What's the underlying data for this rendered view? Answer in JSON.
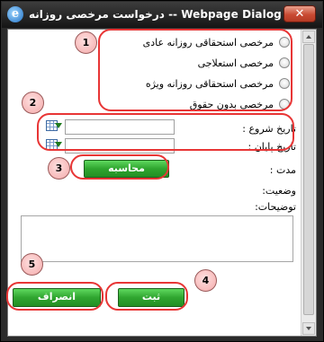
{
  "window": {
    "title": "درخواست مرخصی روزانه -- Webpage Dialog",
    "icon": "ie-icon",
    "close_label": "✕"
  },
  "leave_types": [
    {
      "label": "مرخصی استحقاقی روزانه عادی"
    },
    {
      "label": "مرخصی استعلاجی"
    },
    {
      "label": "مرخصی استحقاقی روزانه ویژه"
    },
    {
      "label": "مرخصی بدون حقوق"
    }
  ],
  "form": {
    "start_date_label": "تاریخ شروع :",
    "start_date_value": "",
    "end_date_label": "تاریخ پایان :",
    "end_date_value": "",
    "calculate_label": "محاسبه",
    "duration_label": "مدت :",
    "status_label": "وضعیت:",
    "notes_label": "توضیحات:",
    "notes_value": ""
  },
  "actions": {
    "submit_label": "ثبت",
    "cancel_label": "انصراف"
  },
  "annotations": [
    "1",
    "2",
    "3",
    "4",
    "5"
  ],
  "colors": {
    "titlebar": "#1e1e1e",
    "button_green": "#2fa52f",
    "highlight_red": "#e83535",
    "badge_pink": "#f3a9a9"
  }
}
